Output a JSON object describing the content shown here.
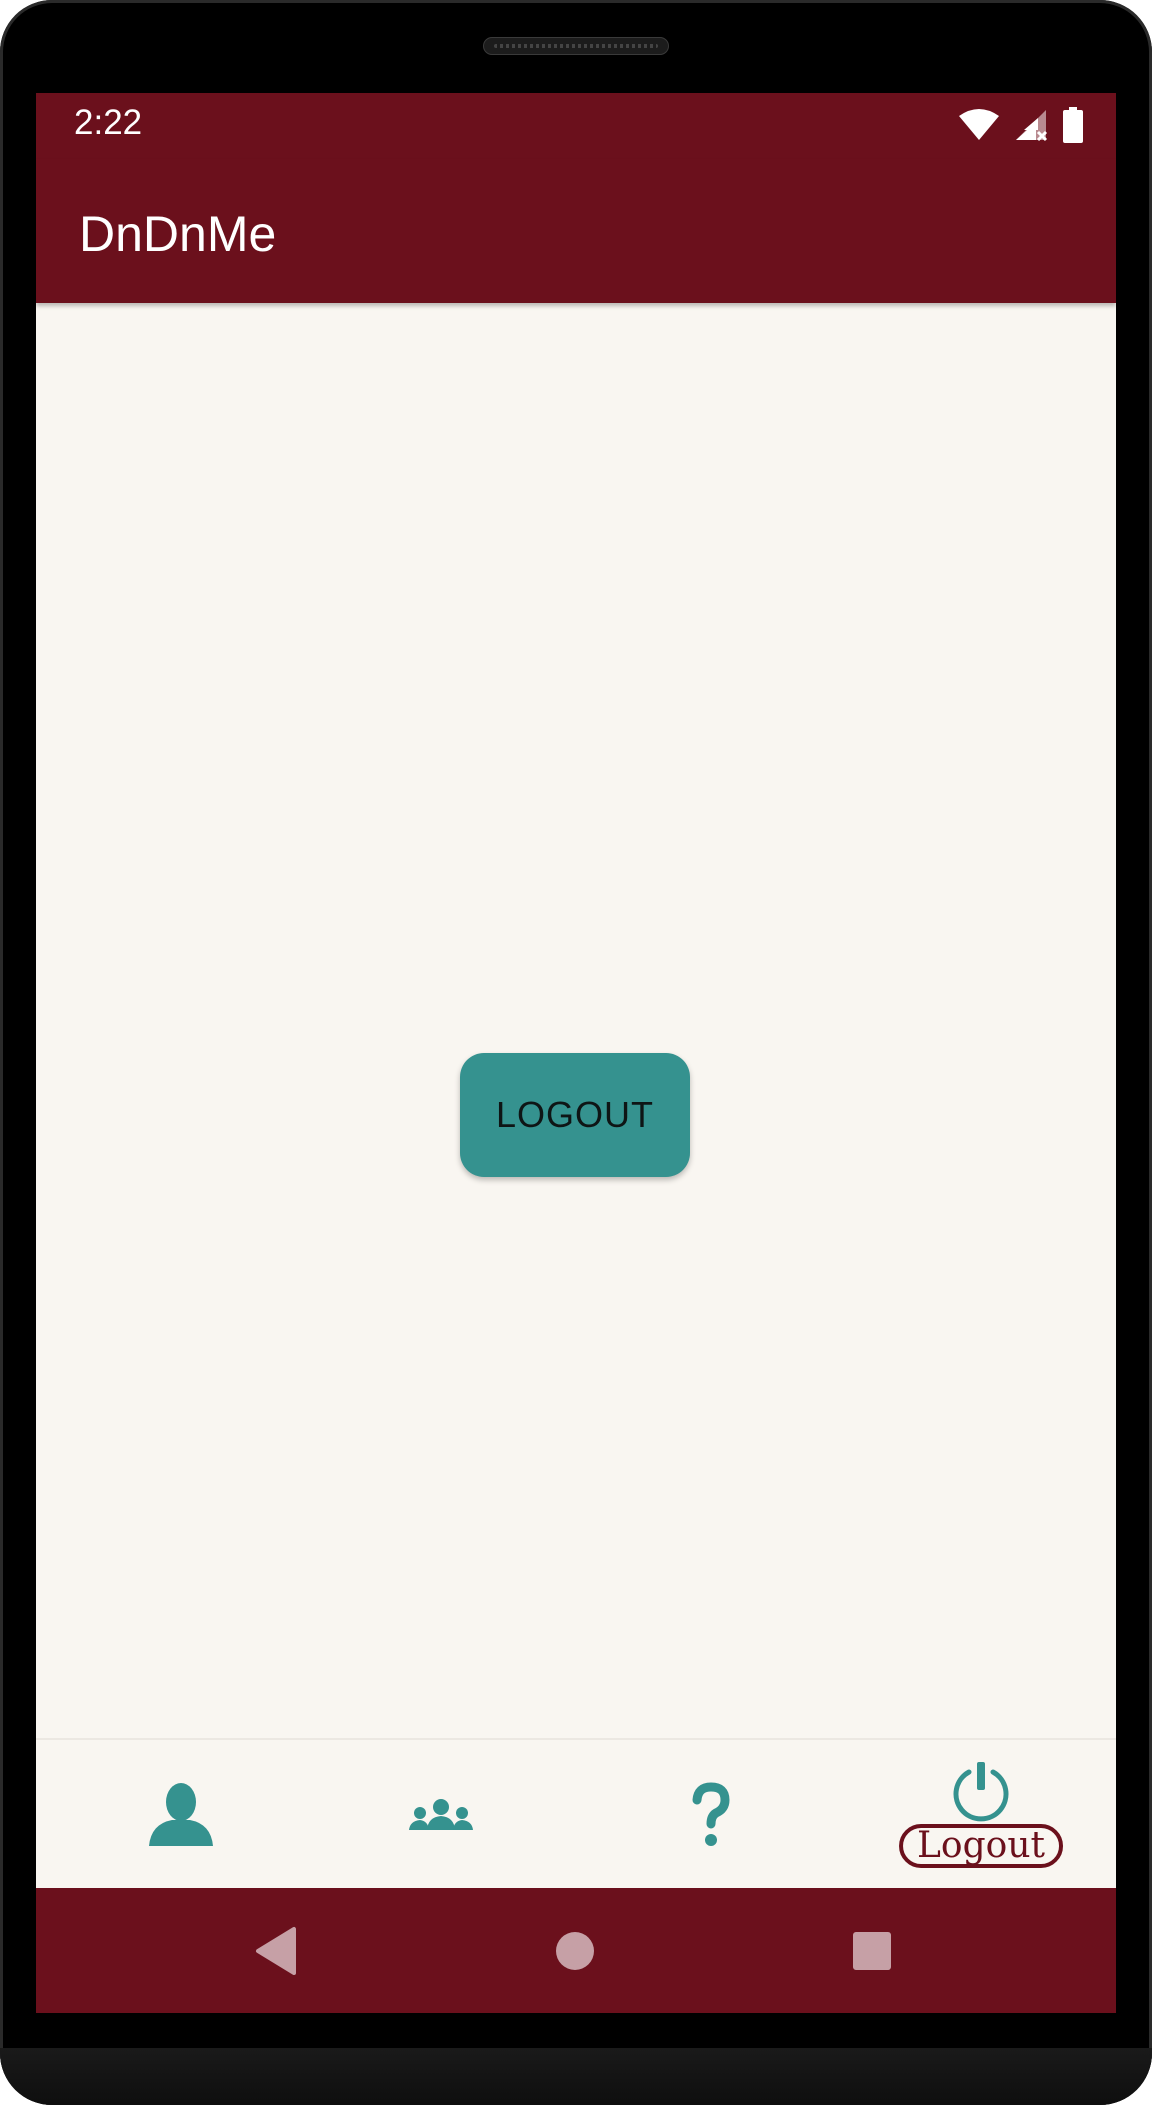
{
  "status_bar": {
    "time": "2:22",
    "icons": [
      "wifi-icon",
      "cellular-no-signal-icon",
      "battery-icon"
    ]
  },
  "app_bar": {
    "title": "DnDnMe"
  },
  "main": {
    "logout_button_label": "LOGOUT"
  },
  "bottom_nav": {
    "items": [
      {
        "icon": "profile-icon",
        "label": ""
      },
      {
        "icon": "group-icon",
        "label": ""
      },
      {
        "icon": "help-icon",
        "label": ""
      },
      {
        "icon": "power-icon",
        "label": "Logout",
        "selected": true
      }
    ]
  },
  "system_nav": {
    "buttons": [
      "back-icon",
      "home-icon",
      "recents-icon"
    ]
  },
  "colors": {
    "primary": "#6b101c",
    "accent": "#35928f",
    "background": "#f9f6f1"
  }
}
